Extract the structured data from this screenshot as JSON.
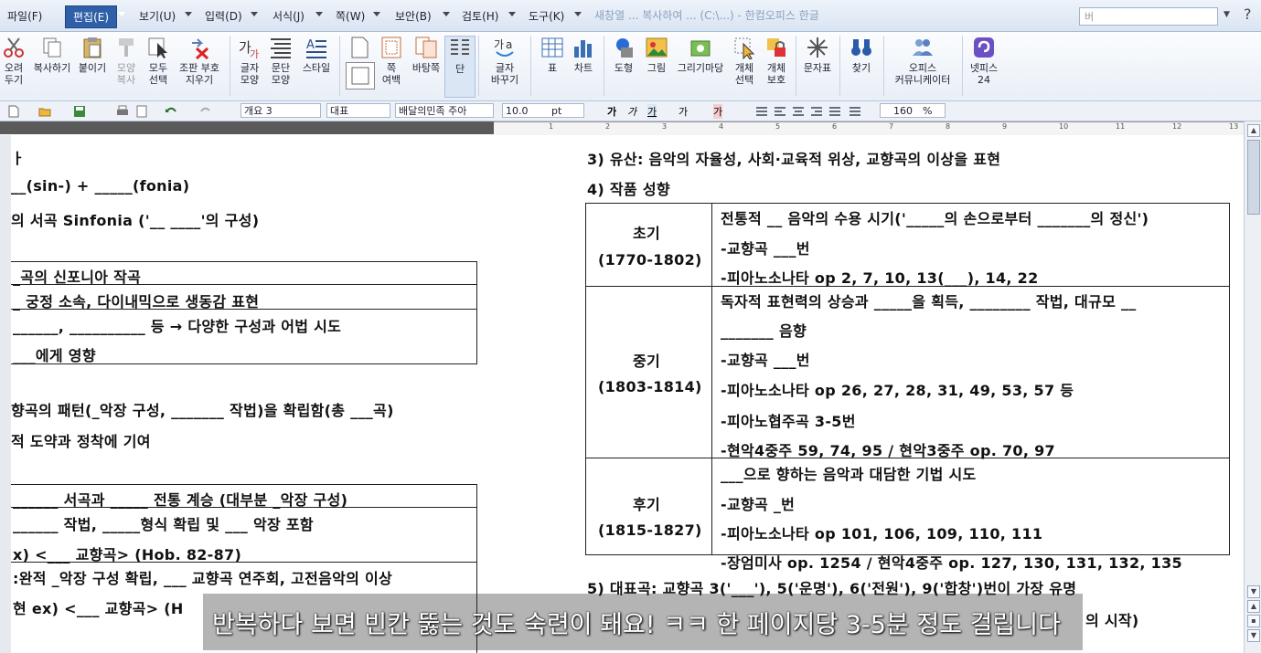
{
  "menubar": {
    "items": [
      "파일(F)",
      "편집(E)",
      "보기(U)",
      "입력(D)",
      "서식(J)",
      "쪽(W)",
      "보안(B)",
      "검토(H)",
      "도구(K)"
    ],
    "title": "새창열 ... 복사하여 ... (C:\\...) - 한컴오피스 한글",
    "search_placeholder": "버"
  },
  "ribbon": {
    "cut": "오려\n두기",
    "copy": "복사하기",
    "paste": "붙이기",
    "format_copy": "모양\n복사",
    "select_all": "모두\n선택",
    "remove_codes": "조판 부호\n지우기",
    "char_shape": "글자\n모양",
    "para_shape": "문단\n모양",
    "style": "스타일",
    "page_margin": "쪽\n여백",
    "background": "바탕쪽",
    "columns": "단",
    "char_replace": "글자\n바꾸기",
    "table": "표",
    "chart": "차트",
    "shapes": "도형",
    "picture": "그림",
    "drawing": "그리기마당",
    "obj_select": "개체\n선택",
    "obj_protect": "개체\n보호",
    "symbol": "문자표",
    "find": "찾기",
    "office_comm": "오피스\n커뮤니케이터",
    "netffice": "넷피스\n24"
  },
  "toolbar2": {
    "outline": "개요 3",
    "style": "대표",
    "font": "배달의민족 주아",
    "size": "10.0",
    "unit": "pt",
    "zoom": "160",
    "zoom_unit": "%"
  },
  "left_page": {
    "l1": "ㅏ",
    "l2": "__(sin-) + _____(fonia)",
    "l3": "의 서곡 Sinfonia ('__ ____'의 구성)",
    "box1_r1": "_곡의 신포니아 작곡",
    "box1_r2": "_ 궁정 소속, 다이내믹으로 생동감 표현",
    "box1_r3": "______, __________ 등 → 다양한 구성과 어법 시도",
    "box1_r4": "___에게 영향",
    "l4": "향곡의 패턴(_악장 구성, _______ 작법)을 확립함(총 ___곡)",
    "l5": "적 도약과 정착에 기여",
    "box2_r1": "______ 서곡과 _____ 전통 계승 (대부분 _악장 구성)",
    "box2_r2": "______ 작법, _____형식 확립 및 ___ 악장 포함",
    "box2_r3": "x) <___ 교향곡> (Hob. 82-87)",
    "box2_r4": ":완적 _악장 구성 확립, ___ 교향곡 연주회, 고전음악의 이상",
    "box2_r5": "현 ex) <___ 교향곡> (H"
  },
  "right_page": {
    "h3": "3) 유산: 음악의 자율성, 사회·교육적 위상, 교향곡의 이상을 표현",
    "h4": "4) 작품 성향",
    "early_name": "초기",
    "early_years": "(1770-1802)",
    "early_r1": "전통적 __ 음악의 수용 시기('_____의 손으로부터 _______의 정신')",
    "early_r2": "-교향곡 ___번",
    "early_r3": "-피아노소나타 op 2, 7, 10, 13(___), 14, 22",
    "mid_name": "중기",
    "mid_years": "(1803-1814)",
    "mid_r1": "독자적 표현력의 상승과 _____을 획득, ________ 작법, 대규모 __",
    "mid_r2": "_______ 음향",
    "mid_r3": "-교향곡 ___번",
    "mid_r4": "-피아노소나타 op 26, 27, 28, 31, 49, 53, 57 등",
    "mid_r5": "-피아노협주곡 3-5번",
    "mid_r6": "-현악4중주 59, 74, 95 / 현악3중주 op. 70, 97",
    "late_name": "후기",
    "late_years": "(1815-1827)",
    "late_r1": "___으로 향하는 음악과 대담한 기법 시도",
    "late_r2": "-교향곡 _번",
    "late_r3": "-피아노소나타 op 101, 106, 109, 110, 111",
    "late_r4": "-장엄미사 op. 1254 / 현악4중주 op. 127, 130, 131, 132, 135",
    "h5": "5) 대표곡: 교향곡 3('___'), 5('운명'), 6('전원'), 9('합창')번이 가장 유명",
    "h5b": "의 시작)"
  },
  "subtitle": "반복하다 보면 빈칸 뚫는 것도 숙련이 돼요! ㅋㅋ 한 페이지당 3-5분 정도 걸립니다",
  "ruler_numbers": [
    "1",
    "2",
    "3",
    "4",
    "5",
    "6",
    "7",
    "8",
    "9",
    "10",
    "11",
    "12",
    "13"
  ],
  "colors": {
    "menu_active": "#2f5fa8",
    "ribbon_bg": "#e9eff7",
    "subtitle_bg": "rgba(40,40,40,0.35)"
  }
}
